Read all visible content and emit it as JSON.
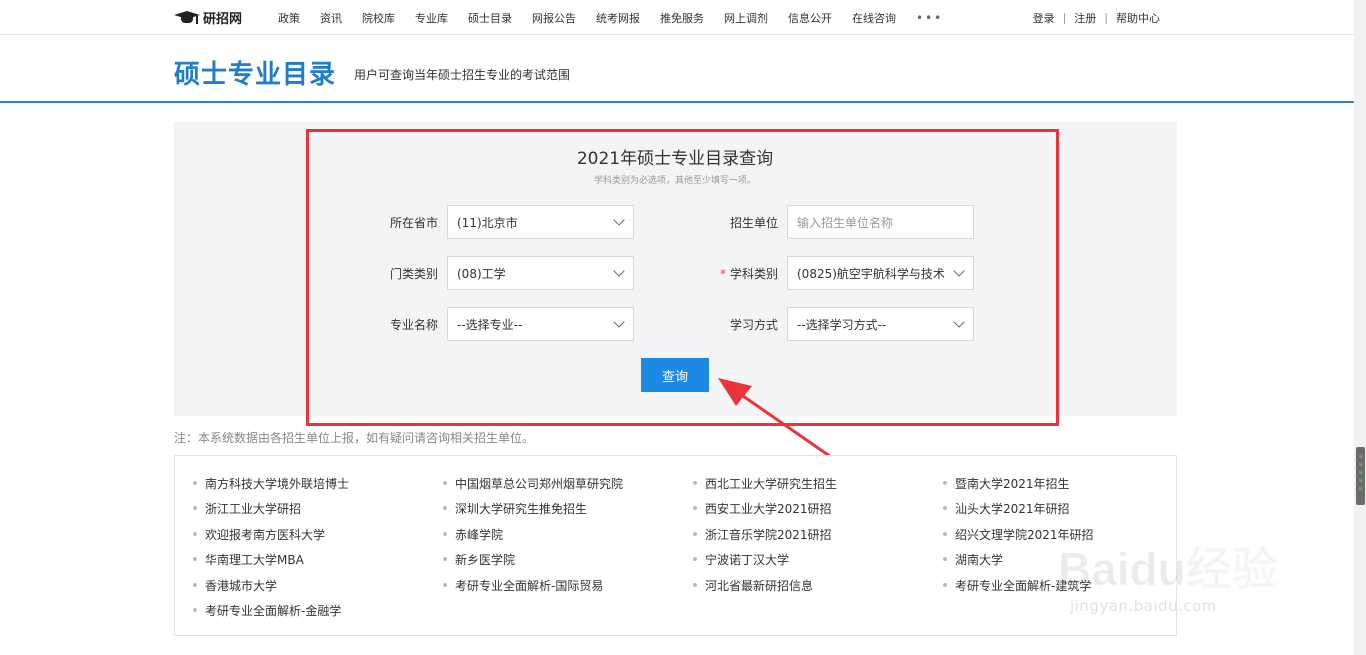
{
  "site": {
    "logo_text": "研招网"
  },
  "nav": {
    "items": [
      "政策",
      "资讯",
      "院校库",
      "专业库",
      "硕士目录",
      "网报公告",
      "统考网报",
      "推免服务",
      "网上调剂",
      "信息公开",
      "在线咨询"
    ],
    "more": "•••"
  },
  "toplinks": {
    "login": "登录",
    "register": "注册",
    "help": "帮助中心",
    "sep": "|"
  },
  "header": {
    "title": "硕士专业目录",
    "subtitle": "用户可查询当年硕士招生专业的考试范围"
  },
  "query": {
    "title": "2021年硕士专业目录查询",
    "note": "学科类别为必选项，其他至少填写一项。",
    "province_label": "所在省市",
    "province_value": "(11)北京市",
    "unit_label": "招生单位",
    "unit_placeholder": "输入招生单位名称",
    "category_label": "门类类别",
    "category_value": "(08)工学",
    "discipline_required": "*",
    "discipline_label": "学科类别",
    "discipline_value": "(0825)航空宇航科学与技术",
    "major_label": "专业名称",
    "major_value": "--选择专业--",
    "mode_label": "学习方式",
    "mode_value": "--选择学习方式--",
    "submit": "查询"
  },
  "footnote": "注：本系统数据由各招生单位上报，如有疑问请咨询相关招生单位。",
  "links": {
    "col1": [
      "南方科技大学境外联培博士",
      "浙江工业大学研招",
      "欢迎报考南方医科大学",
      "华南理工大学MBA",
      "香港城市大学",
      "考研专业全面解析-金融学"
    ],
    "col2": [
      "中国烟草总公司郑州烟草研究院",
      "深圳大学研究生推免招生",
      "赤峰学院",
      "新乡医学院",
      "考研专业全面解析-国际贸易"
    ],
    "col3": [
      "西北工业大学研究生招生",
      "西安工业大学2021研招",
      "浙江音乐学院2021研招",
      "宁波诺丁汉大学",
      "河北省最新研招信息"
    ],
    "col4": [
      "暨南大学2021年招生",
      "汕头大学2021年研招",
      "绍兴文理学院2021年研招",
      "湖南大学",
      "考研专业全面解析-建筑学"
    ]
  },
  "watermark": {
    "logo": "Baidu经验",
    "url": "jingyan.baidu.com"
  },
  "colors": {
    "brand_blue": "#1f7dc9",
    "button_blue": "#1e88e5",
    "highlight_red": "#e8343a"
  }
}
